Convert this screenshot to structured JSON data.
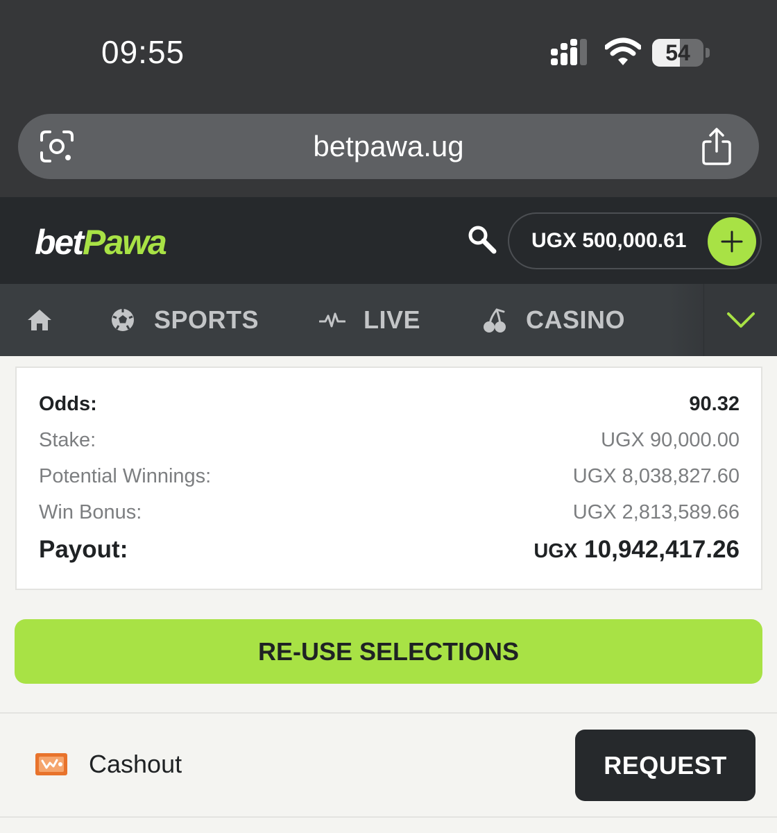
{
  "status_bar": {
    "time": "09:55",
    "battery_level": "54",
    "battery_fraction": 0.54,
    "icons": [
      "cellular-signal-icon",
      "wifi-icon",
      "battery-icon"
    ]
  },
  "browser": {
    "url": "betpawa.ug",
    "icons": [
      "visual-lookup-icon",
      "share-icon"
    ]
  },
  "header": {
    "logo_part1": "bet",
    "logo_part2": "Pawa",
    "balance": "UGX 500,000.61",
    "icons": [
      "search-icon",
      "plus-icon"
    ]
  },
  "nav": {
    "items": [
      {
        "label": "",
        "icon": "home-icon"
      },
      {
        "label": "SPORTS",
        "icon": "soccer-ball-icon"
      },
      {
        "label": "LIVE",
        "icon": "pulse-icon"
      },
      {
        "label": "CASINO",
        "icon": "cherries-icon"
      }
    ],
    "more_icon": "chevron-down-icon"
  },
  "summary": {
    "odds_label": "Odds:",
    "odds_value": "90.32",
    "stake_label": "Stake:",
    "stake_value": "UGX 90,000.00",
    "potential_label": "Potential Winnings:",
    "potential_value": "UGX 8,038,827.60",
    "bonus_label": "Win Bonus:",
    "bonus_value": "UGX 2,813,589.66",
    "payout_label": "Payout:",
    "payout_currency": "UGX",
    "payout_amount": "10,942,417.26"
  },
  "actions": {
    "reuse_label": "RE-USE SELECTIONS",
    "cashout_label": "Cashout",
    "request_label": "REQUEST"
  },
  "colors": {
    "brand_green": "#a8e245",
    "header_dark": "#26292c",
    "nav_bg": "#3a3e41",
    "cashout_orange": "#e8732c"
  }
}
